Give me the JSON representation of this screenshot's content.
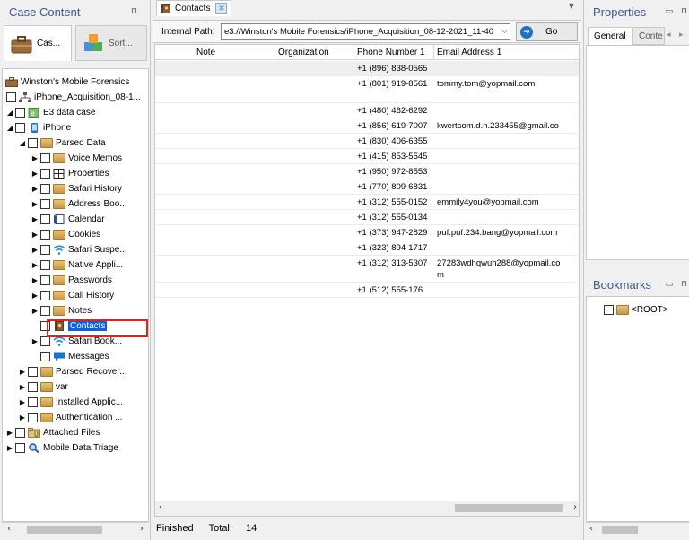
{
  "left_pane": {
    "title": "Case Content",
    "pin": "⊓",
    "tabs": [
      {
        "label": "Cas...",
        "icon": "briefcase-icon"
      },
      {
        "label": "Sort...",
        "icon": "cubes-icon"
      }
    ],
    "tree": [
      {
        "label": "Winston's Mobile Forensics",
        "level": 0,
        "expander": "none",
        "checkbox": false,
        "icon": "briefcase-icon"
      },
      {
        "label": "iPhone_Acquisition_08-1...",
        "level": 0,
        "expander": "none",
        "checkbox": true,
        "icon": "network-icon"
      },
      {
        "label": "E3 data case",
        "level": 0,
        "expander": "expanded",
        "checkbox": true,
        "icon": "e3-case-icon"
      },
      {
        "label": "iPhone",
        "level": 1,
        "expander": "expanded",
        "checkbox": true,
        "icon": "phone-icon"
      },
      {
        "label": "Parsed Data",
        "level": 2,
        "expander": "expanded",
        "checkbox": true,
        "icon": "folder-icon"
      },
      {
        "label": "Voice Memos",
        "level": 3,
        "expander": "collapsed",
        "checkbox": true,
        "icon": "folder-icon"
      },
      {
        "label": "Properties",
        "level": 3,
        "expander": "collapsed",
        "checkbox": true,
        "icon": "grid-icon"
      },
      {
        "label": "Safari History",
        "level": 3,
        "expander": "collapsed",
        "checkbox": true,
        "icon": "folder-icon"
      },
      {
        "label": "Address Boo...",
        "level": 3,
        "expander": "collapsed",
        "checkbox": true,
        "icon": "folder-icon"
      },
      {
        "label": "Calendar",
        "level": 3,
        "expander": "collapsed",
        "checkbox": true,
        "icon": "calendar-icon"
      },
      {
        "label": "Cookies",
        "level": 3,
        "expander": "collapsed",
        "checkbox": true,
        "icon": "folder-icon"
      },
      {
        "label": "Safari Suspe...",
        "level": 3,
        "expander": "collapsed",
        "checkbox": true,
        "icon": "wifi-icon"
      },
      {
        "label": "Native Appli...",
        "level": 3,
        "expander": "collapsed",
        "checkbox": true,
        "icon": "folder-icon"
      },
      {
        "label": "Passwords",
        "level": 3,
        "expander": "collapsed",
        "checkbox": true,
        "icon": "folder-icon"
      },
      {
        "label": "Call History",
        "level": 3,
        "expander": "collapsed",
        "checkbox": true,
        "icon": "folder-icon"
      },
      {
        "label": "Notes",
        "level": 3,
        "expander": "collapsed",
        "checkbox": true,
        "icon": "folder-icon"
      },
      {
        "label": "Contacts",
        "level": 3,
        "expander": "none",
        "checkbox": true,
        "icon": "contacts-book-icon",
        "selected": true
      },
      {
        "label": "Safari Book...",
        "level": 3,
        "expander": "collapsed",
        "checkbox": true,
        "icon": "wifi-icon"
      },
      {
        "label": "Messages",
        "level": 3,
        "expander": "none",
        "checkbox": true,
        "icon": "chat-bubble-icon"
      },
      {
        "label": "Parsed Recover...",
        "level": 2,
        "expander": "collapsed",
        "checkbox": true,
        "icon": "folder-icon"
      },
      {
        "label": "var",
        "level": 2,
        "expander": "collapsed",
        "checkbox": true,
        "icon": "folder-icon"
      },
      {
        "label": "Installed Applic...",
        "level": 2,
        "expander": "collapsed",
        "checkbox": true,
        "icon": "folder-icon"
      },
      {
        "label": "Authentication ...",
        "level": 2,
        "expander": "collapsed",
        "checkbox": true,
        "icon": "folder-icon"
      },
      {
        "label": "Attached Files",
        "level": 1,
        "expander": "collapsed",
        "checkbox": true,
        "icon": "attached-folder-icon"
      },
      {
        "label": "Mobile Data Triage",
        "level": 1,
        "expander": "collapsed",
        "checkbox": true,
        "icon": "magnifier-icon"
      }
    ]
  },
  "center": {
    "tab_label": "Contacts",
    "tab_close": "✕",
    "path_label": "Internal Path:",
    "path_value": "e3://Winston's Mobile Forensics/iPhone_Acquisition_08-12-2021_11-40",
    "go_label": "Go",
    "columns": [
      "Note",
      "Organization",
      "Phone Number 1",
      "Email Address 1"
    ],
    "rows": [
      {
        "note": "",
        "org": "",
        "phone": "+1 (896) 838-0565",
        "email": "",
        "selected": true
      },
      {
        "note": "",
        "org": "",
        "phone": "+1 (801) 919-8561",
        "email": "tommy.tom@yopmail.com",
        "tall": true
      },
      {
        "note": "",
        "org": "",
        "phone": "+1 (480) 462-6292",
        "email": ""
      },
      {
        "note": "",
        "org": "",
        "phone": "+1 (856) 619-7007",
        "email": "kwertsom.d.n.233455@gmail.co"
      },
      {
        "note": "",
        "org": "",
        "phone": "+1 (830) 406-6355",
        "email": ""
      },
      {
        "note": "",
        "org": "",
        "phone": "+1 (415) 853-5545",
        "email": ""
      },
      {
        "note": "",
        "org": "",
        "phone": "+1 (950) 972-8553",
        "email": ""
      },
      {
        "note": "",
        "org": "",
        "phone": "+1 (770) 809-6831",
        "email": ""
      },
      {
        "note": "",
        "org": "",
        "phone": "+1 (312) 555-0152",
        "email": "emmily4you@yopmail.com"
      },
      {
        "note": "",
        "org": "",
        "phone": "+1 (312) 555-0134",
        "email": ""
      },
      {
        "note": "",
        "org": "",
        "phone": "+1 (373) 947-2829",
        "email": "puf.puf.234.bang@yopmail.com"
      },
      {
        "note": "",
        "org": "",
        "phone": "+1 (323) 894-1717",
        "email": ""
      },
      {
        "note": "",
        "org": "",
        "phone": "+1 (312) 313-5307",
        "email": "27283wdhqwuh288@yopmail.co",
        "email_wrap": "m",
        "tall": true
      },
      {
        "note": "",
        "org": "",
        "phone": "+1 (512) 555-176",
        "email": ""
      }
    ],
    "status_text": "Finished",
    "total_label": "Total:",
    "total_value": "14"
  },
  "right_pane": {
    "properties_title": "Properties",
    "tabs": [
      "General",
      "Conte"
    ],
    "bookmarks_title": "Bookmarks",
    "bookmark_root": "<ROOT>"
  }
}
